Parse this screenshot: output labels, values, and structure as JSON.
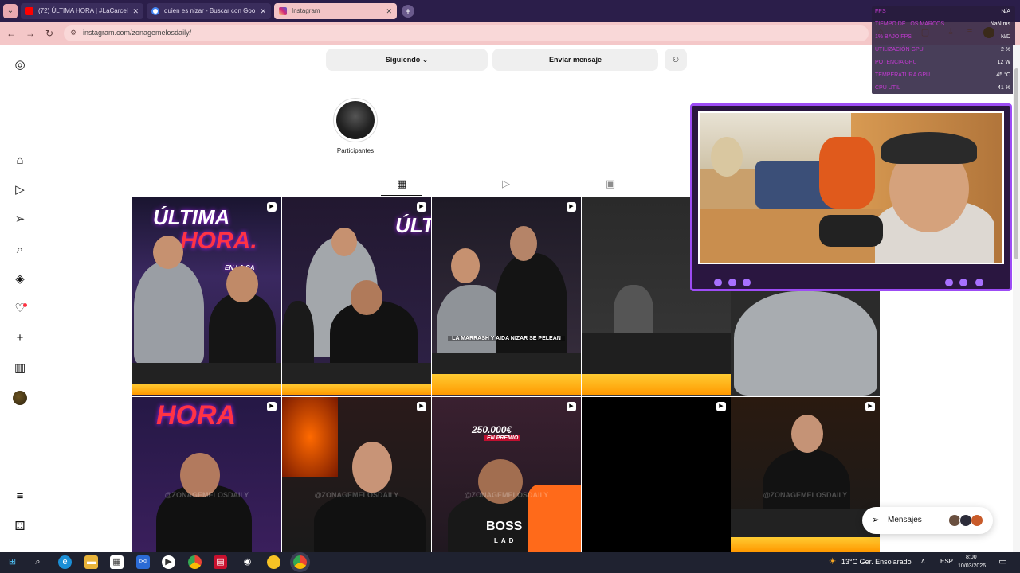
{
  "browser": {
    "tabs": [
      {
        "label": "(72) ÚLTIMA HORA | #LaCarcel",
        "favicon_color": "#ff0000"
      },
      {
        "label": "quien es nizar - Buscar con Goo",
        "favicon_color": "#4285f4"
      },
      {
        "label": "Instagram",
        "favicon_color": "#d6249f"
      }
    ],
    "url": "instagram.com/zonagemelosdaily/"
  },
  "perf_overlay": {
    "rows": [
      {
        "label": "FPS",
        "value": "N/A"
      },
      {
        "label": "TIEMPO DE LOS MARCOS",
        "value": "NaN ms"
      },
      {
        "label": "1% BAJO FPS",
        "value": "N/D"
      },
      {
        "label": "UTILIZACIÓN GPU",
        "value": "2 %"
      },
      {
        "label": "POTENCIA GPU",
        "value": "12 W"
      },
      {
        "label": "TEMPERATURA GPU",
        "value": "45 °C"
      },
      {
        "label": "CPU UTIL",
        "value": "41 %"
      }
    ]
  },
  "profile": {
    "following_label": "Siguiendo",
    "message_label": "Enviar mensaje",
    "highlight_label": "Participantes"
  },
  "grid": {
    "captions": [
      "LA MARRASH Y AIDA NIZAR SE PELEAN",
      "250.000€",
      "EN PREMIO",
      "BOSS",
      "LAD"
    ],
    "banners": [
      "ÚLTIMA",
      "HORA.",
      "EN LA CA",
      "ÚLTIMA",
      "HORA"
    ],
    "watermarks": [
      "@ZONAGEMELOSDAILY",
      "@ZONAGEMELOSDAILY",
      "@ZONAGEMELOSDAILY",
      "@ZONAGEMELOSDAILY"
    ]
  },
  "messages": {
    "label": "Mensajes"
  },
  "taskbar": {
    "weather": "13°C  Ger. Ensolarado",
    "lang": "ESP",
    "time": "8:00",
    "date": "10/03/2026"
  }
}
